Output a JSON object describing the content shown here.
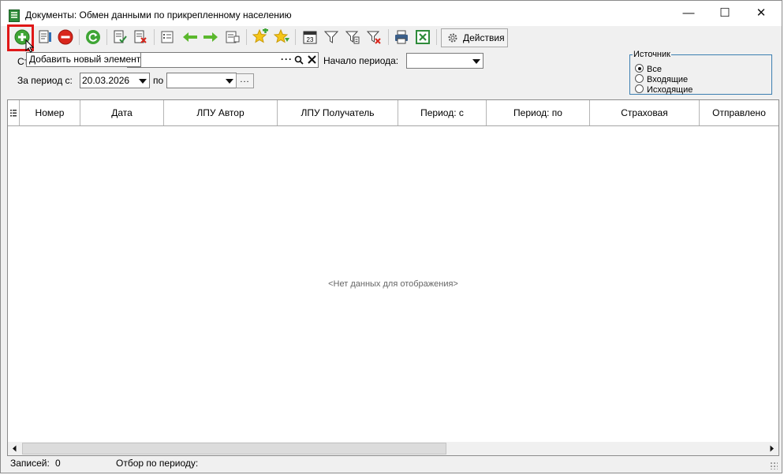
{
  "window": {
    "title": "Документы: Обмен данными по прикрепленному населению",
    "controls": {
      "minimize": "—",
      "maximize": "☐",
      "close": "✕"
    }
  },
  "toolbar": {
    "buttons": [
      {
        "name": "add-button",
        "icon": "plus-circle-icon",
        "tooltip": "Добавить новый элемент"
      },
      {
        "name": "edit-button",
        "icon": "document-edit-icon"
      },
      {
        "name": "delete-button",
        "icon": "minus-circle-icon"
      },
      {
        "name": "refresh-button",
        "icon": "refresh-icon"
      },
      {
        "name": "check-button",
        "icon": "document-check-icon"
      },
      {
        "name": "uncheck-button",
        "icon": "document-x-icon"
      },
      {
        "name": "list-button",
        "icon": "list-icon"
      },
      {
        "name": "back-button",
        "icon": "arrow-left-icon"
      },
      {
        "name": "forward-button",
        "icon": "arrow-right-icon"
      },
      {
        "name": "list-link-button",
        "icon": "list-link-icon"
      },
      {
        "name": "favorite-add-button",
        "icon": "star-plus-icon"
      },
      {
        "name": "favorite-down-button",
        "icon": "star-down-icon"
      },
      {
        "name": "calendar-button",
        "icon": "calendar-icon"
      },
      {
        "name": "filter-button",
        "icon": "filter-icon"
      },
      {
        "name": "filter-edit-button",
        "icon": "filter-edit-icon"
      },
      {
        "name": "filter-clear-button",
        "icon": "filter-clear-icon"
      },
      {
        "name": "print-button",
        "icon": "printer-icon"
      },
      {
        "name": "excel-button",
        "icon": "excel-icon"
      }
    ],
    "actions_label": "Действия"
  },
  "tooltip": "Добавить новый элемент",
  "filters": {
    "status_label_partial": "Ст",
    "status_value": "",
    "period_start_label": "Начало периода:",
    "period_start_value": "",
    "period_from_label": "За период с:",
    "period_from_value": "20.03.2026",
    "period_to_label": "по",
    "period_to_value": "",
    "more_label": "..."
  },
  "source": {
    "title": "Источник",
    "options": [
      {
        "label": "Все",
        "selected": true
      },
      {
        "label": "Входящие",
        "selected": false
      },
      {
        "label": "Исходящие",
        "selected": false
      }
    ]
  },
  "grid": {
    "columns": [
      "Номер",
      "Дата",
      "ЛПУ Автор",
      "ЛПУ Получатель",
      "Период: с",
      "Период: по",
      "Страховая",
      "Отправлено"
    ],
    "empty_message": "<Нет данных для отображения>"
  },
  "status": {
    "records_label": "Записей:",
    "records_value": "0",
    "period_filter_label": "Отбор по периоду:",
    "period_filter_value": ""
  },
  "colors": {
    "accent_red": "#e01818",
    "green_icon": "#3fa535",
    "border_blue": "#3c7fb1"
  }
}
